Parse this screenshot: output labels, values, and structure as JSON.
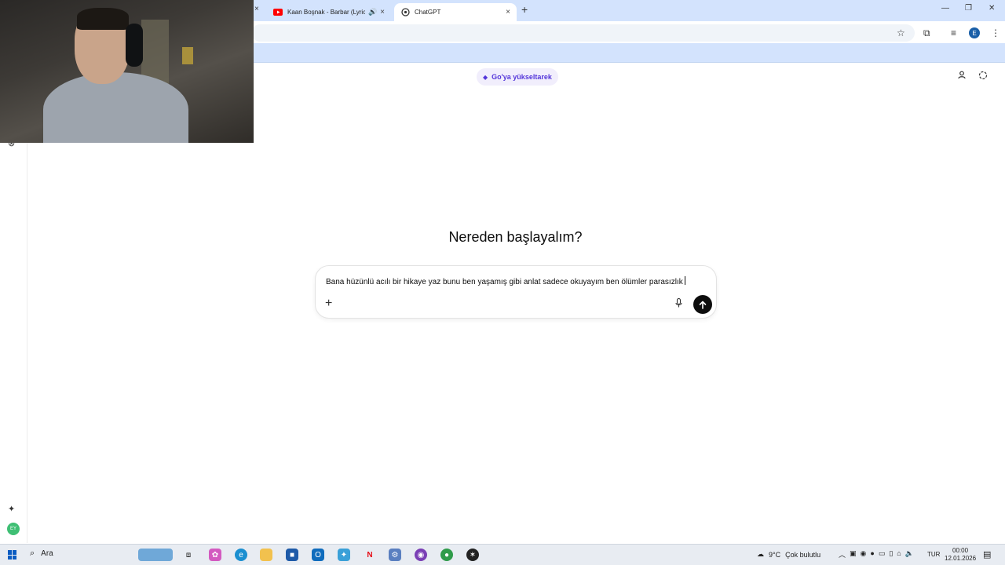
{
  "browser": {
    "tabs": [
      {
        "title": "Kaan Boşnak - Barbar (Lyric",
        "active": false,
        "audio": true
      },
      {
        "title": "ChatGPT",
        "active": true
      }
    ],
    "new_tab_glyph": "+",
    "close_glyph": "×"
  },
  "chatgpt": {
    "upgrade_label": "Go'ya yükseltarek",
    "headline": "Nereden başlayalım?",
    "composer_text": "Bana hüzünlü acılı bir hikaye yaz bunu ben yaşamış gibi anlat sadece okuyayım ben ölümler parasızlık",
    "accent_color": "#5436da",
    "user_initials": "EY"
  },
  "taskbar": {
    "search_label": "Ara",
    "weather_temp": "9°C",
    "weather_text": "Çok bulutlu",
    "language": "TUR",
    "time": "00:00",
    "date": "12.01.2026"
  }
}
